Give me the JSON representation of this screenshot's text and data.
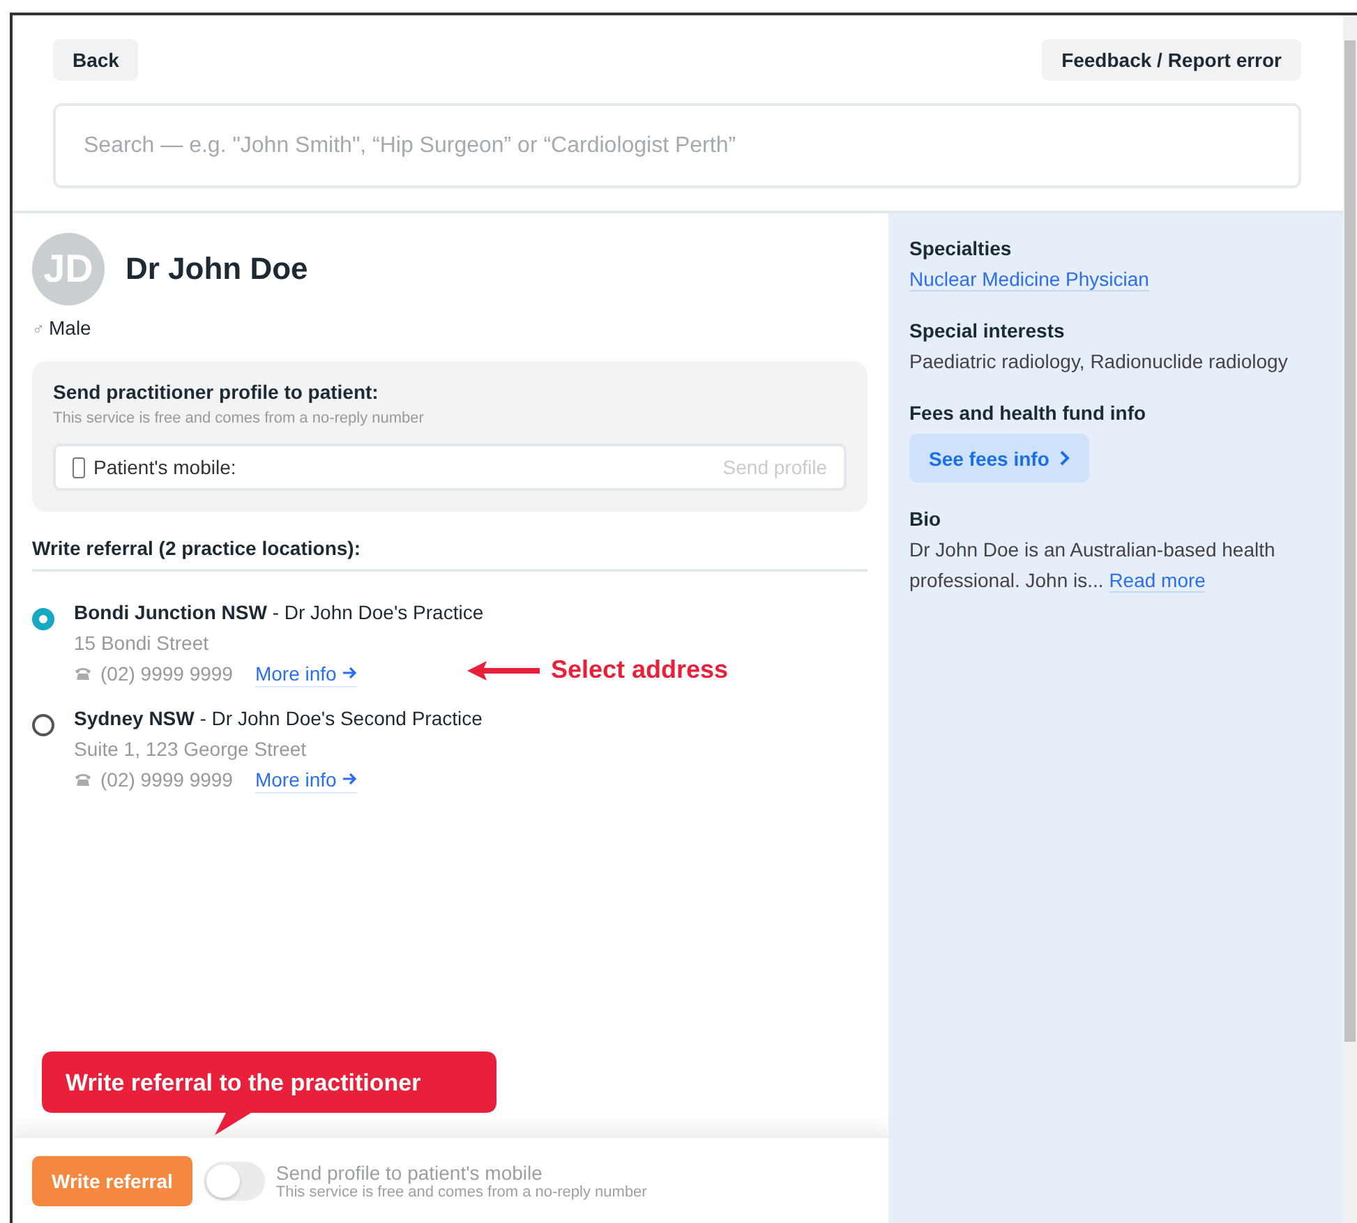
{
  "header": {
    "back_button": "Back",
    "feedback_button": "Feedback / Report error",
    "search": {
      "placeholder": "Search — e.g. \"John Smith\", “Hip Surgeon” or “Cardiologist Perth”"
    }
  },
  "profile": {
    "initials": "JD",
    "name": "Dr John Doe",
    "gender_icon": "♂",
    "gender": "Male"
  },
  "send_profile": {
    "title": "Send practitioner profile to patient:",
    "note": "This service is free and comes from a no-reply number",
    "mobile": {
      "placeholder": "Patient's mobile:"
    },
    "send_button": {
      "label": "Send profile",
      "disabled": true
    }
  },
  "referral": {
    "heading": "Write referral (2 practice locations):",
    "locations": [
      {
        "title": "**Bondi Junction NSW** - Dr John Doe's Practice",
        "address": "15 Bondi Street",
        "phone": "(02) 9999 9999",
        "more_info": "More info",
        "selected": true
      },
      {
        "title": "**Sydney NSW** - Dr John Doe's Second Practice",
        "address": "Suite 1, 123 George Street",
        "phone": "(02) 9999 9999",
        "more_info": "More info",
        "selected": false
      }
    ]
  },
  "sidebar": {
    "sections": [
      {
        "kind": "link",
        "heading": "Specialties",
        "text": "Nuclear Medicine Physician"
      },
      {
        "kind": "text",
        "heading": "Special interests",
        "text": "Paediatric radiology, Radionuclide radiology"
      },
      {
        "kind": "button",
        "heading": "Fees and health fund info",
        "text": "See fees info"
      },
      {
        "kind": "bio",
        "heading": "Bio",
        "text": "Dr John Doe is an Australian-based health professional. John is...",
        "link": "Read more"
      }
    ]
  },
  "footer": {
    "write_button": "Write referral",
    "toggle": {
      "on": false,
      "label": "Send profile to patient's mobile",
      "note": "This service is free and comes from a no-reply number"
    }
  },
  "annotations": [
    {
      "kind": "arrow",
      "text": "Select address"
    },
    {
      "kind": "callout",
      "text": "Write referral to the practitioner"
    }
  ]
}
